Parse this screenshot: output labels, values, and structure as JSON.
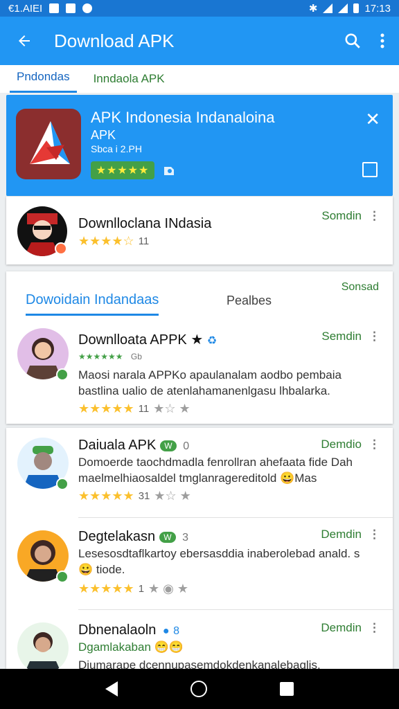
{
  "status": {
    "time_left": "€1.AIЕI",
    "time_right": "17:13"
  },
  "app_bar": {
    "title": "Download APK"
  },
  "tabs": [
    {
      "label": "Pndondas"
    },
    {
      "label": "Inndaola APK"
    }
  ],
  "hero": {
    "title": "APK Indonesia Indanaloina",
    "subtitle": "APK",
    "size": "Sbca i 2.PH",
    "rating_stars": "★★★★★"
  },
  "featured": {
    "title": "Downlloclana INdasia",
    "action": "Somdin",
    "stars": "★★★★☆",
    "count": "11"
  },
  "section": {
    "corner_label": "Sonsad",
    "tab_primary": "Dowoidain Indandaas",
    "tab_secondary": "Pealbes"
  },
  "items1": [
    {
      "title": "Downlloata APPK ★",
      "action": "Semdin",
      "mini_rating": "★★★★★★",
      "mini_label": "Gb",
      "desc": "Maosi narala APPKo apaulanalam aodbo pembaia bastlina ualio de atenlahamanenlgasu lhbalarka.",
      "stars": "★★★★★",
      "count": "11",
      "extra": "★☆ ★"
    }
  ],
  "items2": [
    {
      "title": "Daiuala APK",
      "badge": "W",
      "badge_num": "0",
      "action": "Demdio",
      "desc": "Domoerde taochdmadla fenrollran ahefaata fide Dah maelmelhiaosaldel tmglanragereditold 😀Mas",
      "stars": "★★★★★",
      "count": "31",
      "extra": "★☆ ★"
    },
    {
      "title": "Degtelakasn",
      "badge": "W",
      "badge_num": "3",
      "action": "Demdin",
      "desc": "Lesesosdtaflkartoy ebersasddia inaberolebad anald. s😀 tiode.",
      "stars": "★★★★★",
      "count": "1",
      "extra": "★ ◉ ★"
    },
    {
      "title": "Dbnenalaoln",
      "badge_num": "8",
      "action": "Demdin",
      "subtitle": "Dgamlakaban 😁😁",
      "desc": "Diumarape dcennupasemdokdenkanalebaglis."
    }
  ]
}
